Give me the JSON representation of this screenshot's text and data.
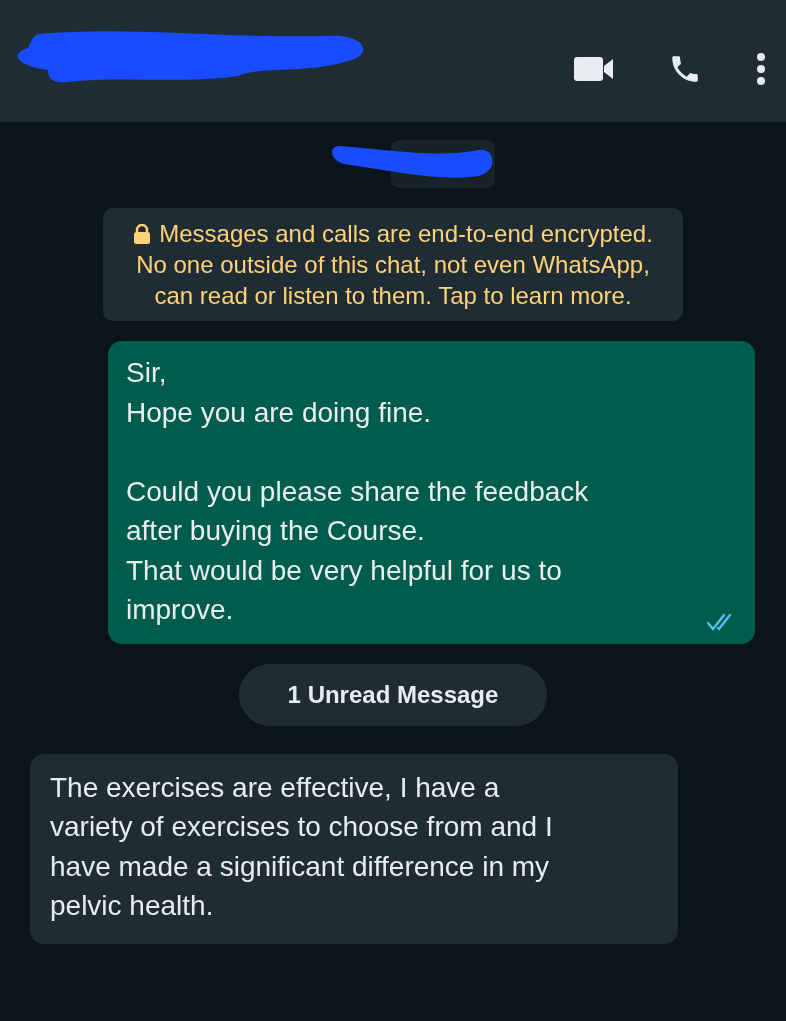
{
  "header": {
    "actions": [
      {
        "kind": "video"
      },
      {
        "kind": "call"
      },
      {
        "kind": "menu"
      }
    ]
  },
  "notice": {
    "text": "Messages and calls are end-to-end encrypted.\nNo one outside of this chat, not even WhatsApp,\ncan read or listen to them. Tap to learn more."
  },
  "messages": [
    {
      "kind": "outgoing",
      "text": "Sir,\nHope you are doing fine.\n\nCould you please share the feedback\nafter buying the Course.\nThat would be very helpful for us to\nimprove.",
      "read": true
    },
    {
      "kind": "divider",
      "text": "1 Unread Message"
    },
    {
      "kind": "incoming",
      "text": "The exercises are effective, I have a\nvariety of exercises to choose from and I\nhave made a significant difference in my\npelvic health."
    }
  ]
}
